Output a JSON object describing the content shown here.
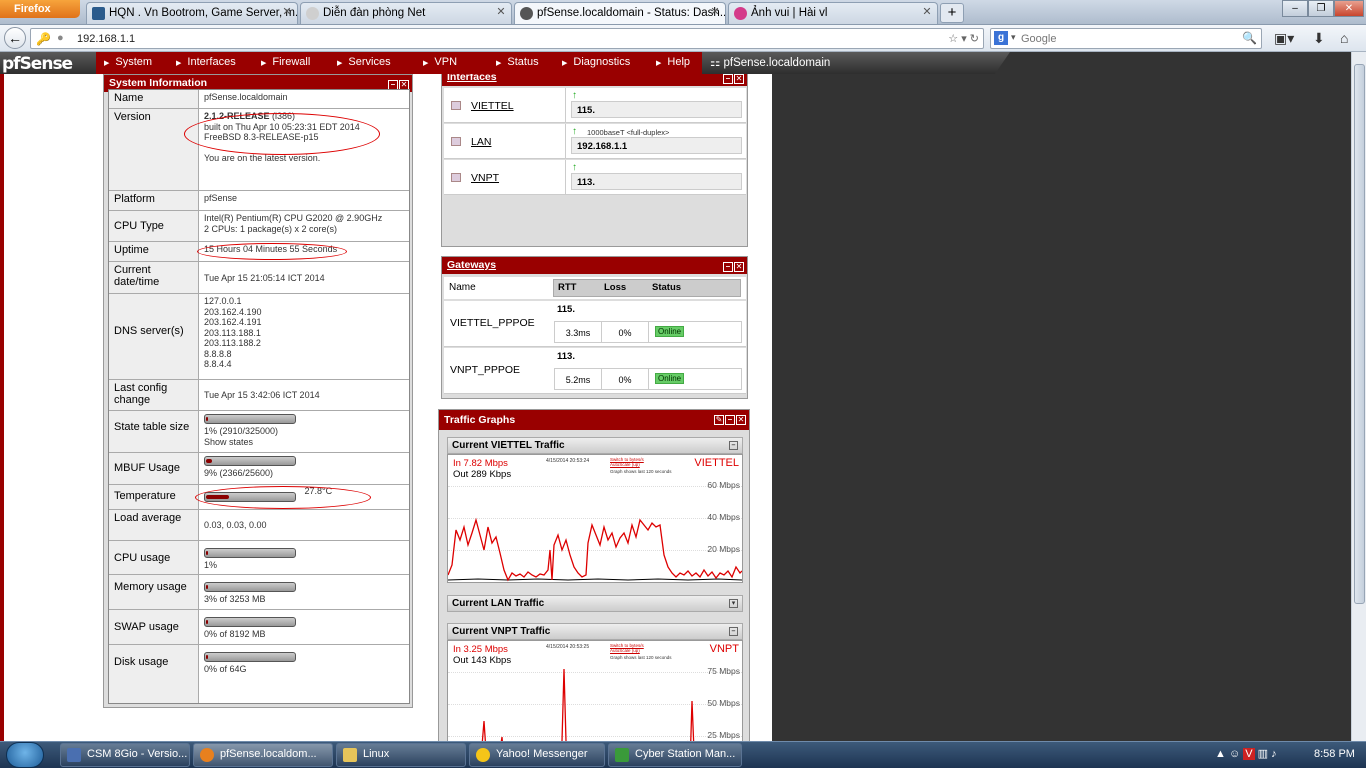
{
  "browser": {
    "app_button": "Firefox",
    "tabs": [
      {
        "label": "HQN . Vn Bootrom, Game Server, m..."
      },
      {
        "label": "Diễn đàn phòng Net"
      },
      {
        "label": "pfSense.localdomain - Status: Dash..."
      },
      {
        "label": "Ảnh vui | Hài vl"
      }
    ],
    "url": "192.168.1.1",
    "search_placeholder": "Google"
  },
  "pfsense": {
    "logo": "pfSense",
    "menu": [
      "System",
      "Interfaces",
      "Firewall",
      "Services",
      "VPN",
      "Status",
      "Diagnostics",
      "Help"
    ],
    "hostname": "pfSense.localdomain"
  },
  "system_info": {
    "title": "System Information",
    "name": {
      "label": "Name",
      "value": "pfSense.localdomain"
    },
    "version": {
      "label": "Version",
      "line1": "2.1.2-RELEASE",
      "arch": "(i386)",
      "line2": "built on Thu Apr 10 05:23:31 EDT 2014",
      "line3": "FreeBSD 8.3-RELEASE-p15",
      "line4": "You are on the latest version."
    },
    "platform": {
      "label": "Platform",
      "value": "pfSense"
    },
    "cpu_type": {
      "label": "CPU Type",
      "line1": "Intel(R) Pentium(R) CPU G2020 @ 2.90GHz",
      "line2": "2 CPUs: 1 package(s) x 2 core(s)"
    },
    "uptime": {
      "label": "Uptime",
      "value": "15 Hours 04 Minutes 55 Seconds"
    },
    "datetime": {
      "label": "Current date/time",
      "value": "Tue Apr 15 21:05:14 ICT 2014"
    },
    "dns": {
      "label": "DNS server(s)",
      "servers": [
        "127.0.0.1",
        "203.162.4.190",
        "203.162.4.191",
        "203.113.188.1",
        "203.113.188.2",
        "8.8.8.8",
        "8.8.4.4"
      ]
    },
    "last_config": {
      "label": "Last config change",
      "value": "Tue Apr 15 3:42:06 ICT 2014"
    },
    "state_table": {
      "label": "State table size",
      "value": "1% (2910/325000)",
      "link": "Show states",
      "fraction": 0.01
    },
    "mbuf": {
      "label": "MBUF Usage",
      "value": "9% (2366/25600)",
      "fraction": 0.09
    },
    "temperature": {
      "label": "Temperature",
      "value": "27.8°C",
      "fraction": 0.28
    },
    "load": {
      "label": "Load average",
      "value": "0.03, 0.03, 0.00"
    },
    "cpu_usage": {
      "label": "CPU usage",
      "value": "1%",
      "fraction": 0.01
    },
    "memory": {
      "label": "Memory usage",
      "value": "3% of 3253 MB",
      "fraction": 0.03
    },
    "swap": {
      "label": "SWAP usage",
      "value": "0% of 8192 MB",
      "fraction": 0.0
    },
    "disk": {
      "label": "Disk usage",
      "value": "0% of 64G",
      "fraction": 0.0
    }
  },
  "interfaces": {
    "title": "Interfaces",
    "rows": [
      {
        "name": "VIETTEL",
        "speed": "",
        "ip": "115."
      },
      {
        "name": "LAN",
        "speed": "1000baseT <full-duplex>",
        "ip": "192.168.1.1"
      },
      {
        "name": "VNPT",
        "speed": "",
        "ip": "113."
      }
    ]
  },
  "gateways": {
    "title": "Gateways",
    "headers": {
      "name": "Name",
      "rtt": "RTT",
      "loss": "Loss",
      "status": "Status"
    },
    "rows": [
      {
        "name": "VIETTEL_PPPOE",
        "ip": "115.",
        "rtt": "3.3ms",
        "loss": "0%",
        "status": "Online"
      },
      {
        "name": "VNPT_PPPOE",
        "ip": "113.",
        "rtt": "5.2ms",
        "loss": "0%",
        "status": "Online"
      }
    ]
  },
  "traffic": {
    "title": "Traffic Graphs",
    "viettel": {
      "header": "Current VIETTEL Traffic",
      "in": "In    7.82 Mbps",
      "out": "Out   289 Kbps",
      "date": "4/15/2014 20:53:24",
      "link1": "Switch to bytes/s",
      "link2": "AutoScale (up)",
      "note": "Graph shows last 120 seconds",
      "label": "VIETTEL",
      "ticks": [
        "60 Mbps",
        "40 Mbps",
        "20 Mbps"
      ]
    },
    "lan": {
      "header": "Current LAN Traffic"
    },
    "vnpt": {
      "header": "Current VNPT Traffic",
      "in": "In    3.25 Mbps",
      "out": "Out   143 Kbps",
      "date": "4/15/2014 20:53:25",
      "link1": "Switch to bytes/s",
      "link2": "AutoScale (up)",
      "note": "Graph shows last 120 seconds",
      "label": "VNPT",
      "ticks": [
        "75 Mbps",
        "50 Mbps",
        "25 Mbps"
      ]
    }
  },
  "taskbar": {
    "items": [
      {
        "label": "CSM 8Gio - Versio..."
      },
      {
        "label": "pfSense.localdom..."
      },
      {
        "label": "Linux"
      },
      {
        "label": "Yahoo! Messenger"
      },
      {
        "label": "Cyber Station Man..."
      }
    ],
    "clock": "8:58 PM"
  },
  "colors": {
    "pfsense_red": "#990000",
    "graph_in": "#dd0000",
    "online": "#66cc66"
  }
}
